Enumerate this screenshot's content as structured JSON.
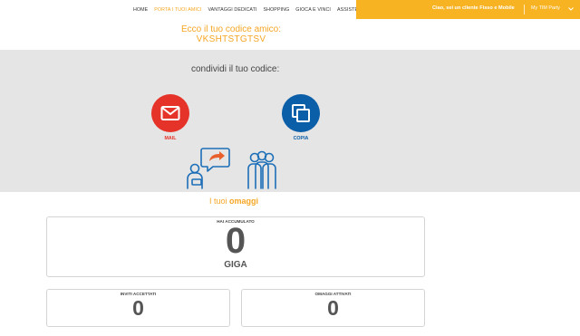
{
  "nav": {
    "items": [
      {
        "label": "HOME",
        "active": false
      },
      {
        "label": "PORTA I TUOI AMICI",
        "active": true
      },
      {
        "label": "VANTAGGI DEDICATI",
        "active": false
      },
      {
        "label": "SHOPPING",
        "active": false
      },
      {
        "label": "GIOCA E VINCI",
        "active": false
      },
      {
        "label": "ASSISTENZA",
        "active": false
      }
    ]
  },
  "user": {
    "greeting": "Ciao, sei un cliente Fisso e Mobile",
    "menu_label": "My TIM Party",
    "chevron_icon": "chevron-down-icon"
  },
  "code": {
    "title": "Ecco il tuo codice amico:",
    "value": "VKSHTSTGTSV"
  },
  "share": {
    "label": "condividi il tuo codice:",
    "mail": {
      "caption": "MAIL",
      "icon": "mail-icon",
      "color": "#e63329"
    },
    "copy": {
      "caption": "COPIA",
      "icon": "copy-icon",
      "color": "#0b5ea8"
    }
  },
  "gifts": {
    "title_prefix": "I tuoi",
    "title_bold": "omaggi",
    "accumulated": {
      "label": "HAI ACCUMULATO",
      "value": "0",
      "unit": "GIGA"
    },
    "accepted": {
      "label": "INVITI ACCETTATI",
      "value": "0"
    },
    "activated": {
      "label": "OMAGGI ATTIVATI",
      "value": "0"
    }
  },
  "colors": {
    "accent": "#f7b322",
    "accent_text": "#f5a623",
    "band": "#e5e5e5",
    "illustration": "#1d6fb8"
  }
}
